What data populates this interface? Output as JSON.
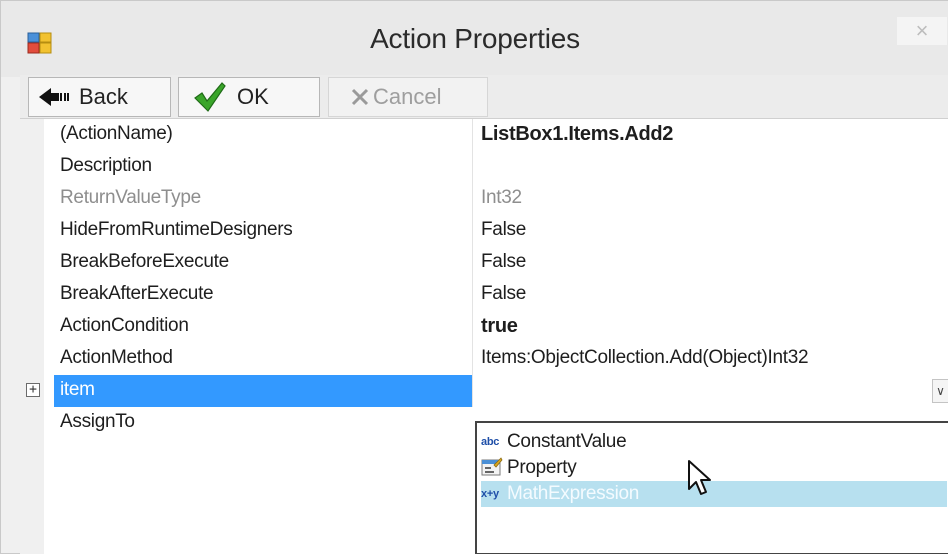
{
  "window": {
    "title": "Action Properties",
    "close_glyph": "×"
  },
  "toolbar": {
    "back_label": "Back",
    "ok_label": "OK",
    "cancel_label": "Cancel"
  },
  "properties": [
    {
      "name": "(ActionName)",
      "value": "ListBox1.Items.Add2",
      "style": "bold"
    },
    {
      "name": "Description",
      "value": ""
    },
    {
      "name": "ReturnValueType",
      "value": "Int32",
      "style": "gray"
    },
    {
      "name": "HideFromRuntimeDesigners",
      "value": "False"
    },
    {
      "name": "BreakBeforeExecute",
      "value": "False"
    },
    {
      "name": "BreakAfterExecute",
      "value": "False"
    },
    {
      "name": "ActionCondition",
      "value": "true",
      "style": "bold"
    },
    {
      "name": "ActionMethod",
      "value": "Items:ObjectCollection.Add(Object)Int32"
    },
    {
      "name": "item",
      "value": "",
      "selected": true,
      "expander": "+"
    },
    {
      "name": "AssignTo",
      "value": ""
    }
  ],
  "dropdown": {
    "arrow_glyph": "∨",
    "items": [
      {
        "label": "ConstantValue",
        "icon_text": "abc",
        "icon": "abc-constant-icon"
      },
      {
        "label": "Property",
        "icon_text": "",
        "icon": "property-icon"
      },
      {
        "label": "MathExpression",
        "icon_text": "x+y",
        "icon": "math-expression-icon",
        "highlighted": true
      }
    ]
  },
  "colors": {
    "selection": "#3399ff",
    "highlight": "#b7e0ef"
  }
}
